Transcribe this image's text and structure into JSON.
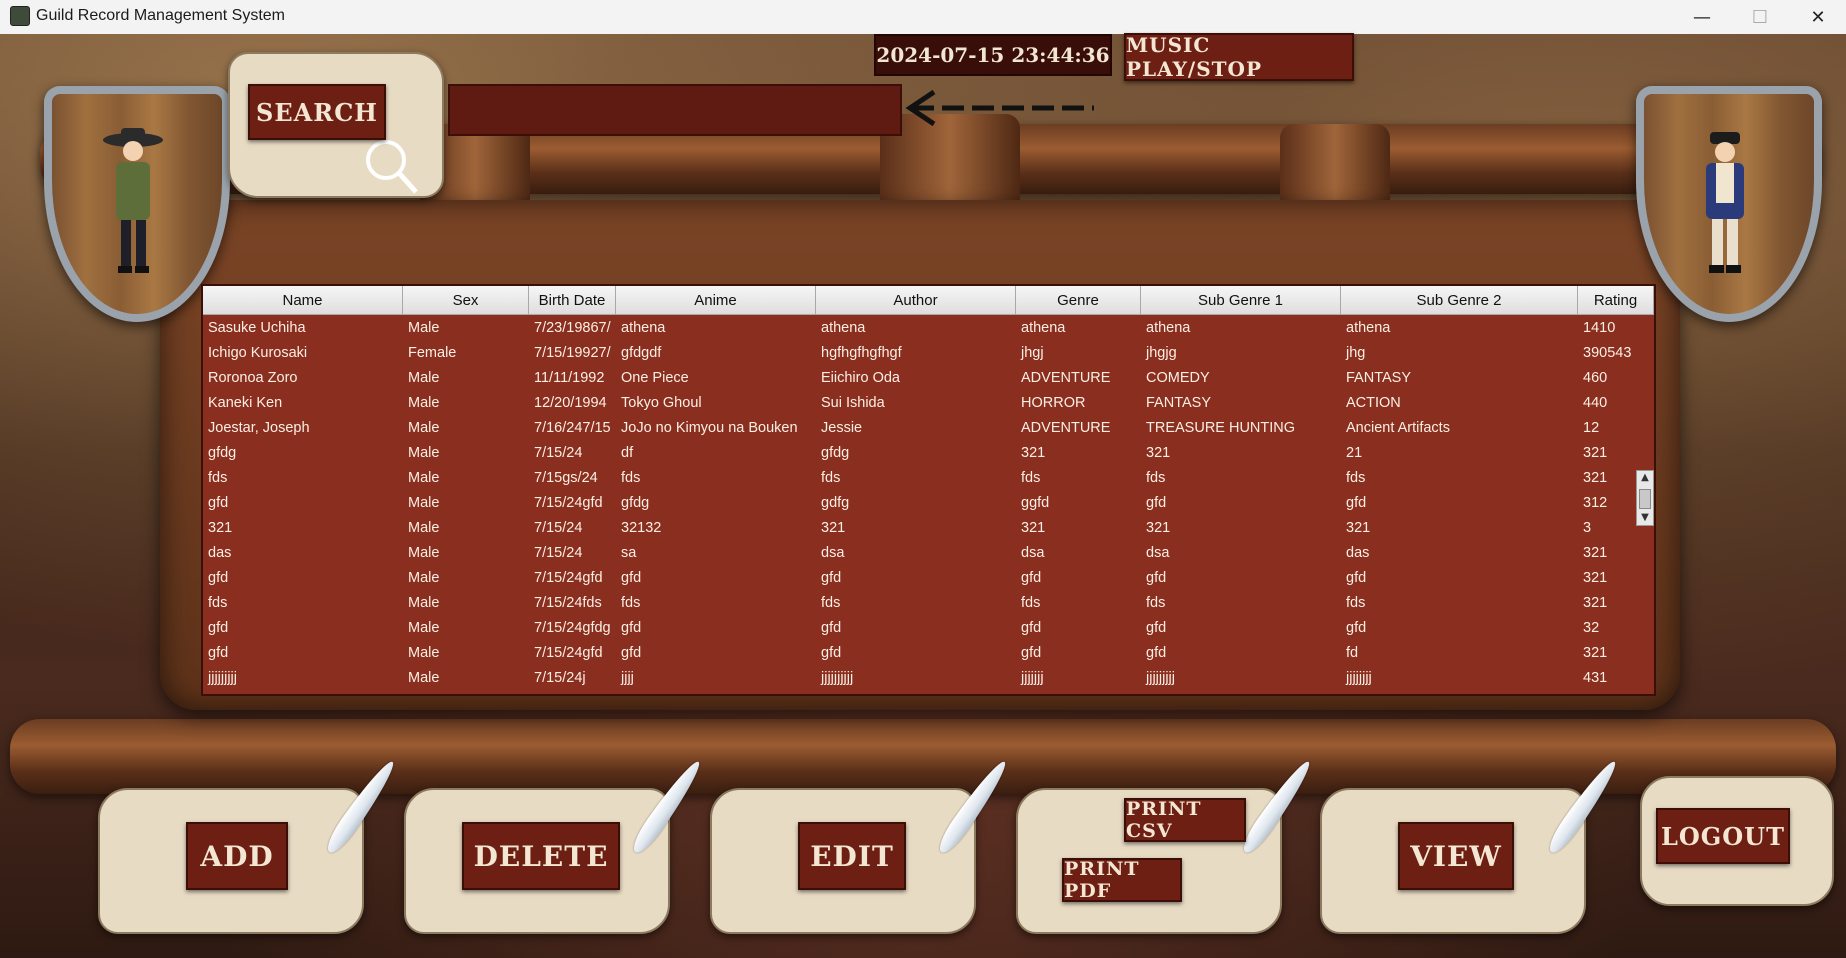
{
  "window": {
    "title": "Guild Record Management System",
    "minimize": "—",
    "maximize": "☐",
    "close": "✕"
  },
  "header": {
    "clock": "2024-07-15 23:44:36",
    "music_label": "MUSIC PLAY/STOP",
    "search_label": "SEARCH",
    "search_value": ""
  },
  "table": {
    "columns": [
      "Name",
      "Sex",
      "Birth Date",
      "Anime",
      "Author",
      "Genre",
      "Sub Genre 1",
      "Sub Genre 2",
      "Rating"
    ],
    "rows": [
      [
        "Sasuke Uchiha",
        "Male",
        "7/23/19867/",
        "athena",
        "athena",
        "athena",
        "athena",
        "athena",
        "1410"
      ],
      [
        "Ichigo Kurosaki",
        "Female",
        "7/15/19927/",
        "gfdgdf",
        "hgfhgfhgfhgf",
        "jhgj",
        "jhgjg",
        "jhg",
        "390543"
      ],
      [
        "Roronoa Zoro",
        "Male",
        "11/11/1992",
        "One Piece",
        "Eiichiro Oda",
        "ADVENTURE",
        "COMEDY",
        "FANTASY",
        "460"
      ],
      [
        "Kaneki Ken",
        "Male",
        "12/20/1994",
        "Tokyo Ghoul",
        "Sui Ishida",
        "HORROR",
        "FANTASY",
        "ACTION",
        "440"
      ],
      [
        "Joestar, Joseph",
        "Male",
        "7/16/247/15",
        "JoJo no Kimyou na Bouken",
        "Jessie",
        "ADVENTURE",
        "TREASURE HUNTING",
        "Ancient Artifacts",
        "12"
      ],
      [
        "gfdg",
        "Male",
        "7/15/24",
        "df",
        "gfdg",
        "321",
        "321",
        "21",
        "321"
      ],
      [
        "fds",
        "Male",
        "7/15gs/24",
        "fds",
        "fds",
        "fds",
        "fds",
        "fds",
        "321"
      ],
      [
        "gfd",
        "Male",
        "7/15/24gfd",
        "gfdg",
        "gdfg",
        "ggfd",
        "gfd",
        "gfd",
        "312"
      ],
      [
        "321",
        "Male",
        "7/15/24",
        "32132",
        "321",
        "321",
        "321",
        "321",
        "3"
      ],
      [
        "das",
        "Male",
        "7/15/24",
        "sa",
        "dsa",
        "dsa",
        "dsa",
        "das",
        "321"
      ],
      [
        "gfd",
        "Male",
        "7/15/24gfd",
        "gfd",
        "gfd",
        "gfd",
        "gfd",
        "gfd",
        "321"
      ],
      [
        "fds",
        "Male",
        "7/15/24fds",
        "fds",
        "fds",
        "fds",
        "fds",
        "fds",
        "321"
      ],
      [
        "gfd",
        "Male",
        "7/15/24gfdg",
        "gfd",
        "gfd",
        "gfd",
        "gfd",
        "gfd",
        "32"
      ],
      [
        "gfd",
        "Male",
        "7/15/24gfd",
        "gfd",
        "gfd",
        "gfd",
        "gfd",
        "fd",
        "321"
      ],
      [
        "jjjjjjjjj",
        "Male",
        "7/15/24j",
        "jjjj",
        "jjjjjjjjjj",
        "jjjjjjj",
        "jjjjjjjjj",
        "jjjjjjjj",
        "431"
      ]
    ]
  },
  "actions": {
    "add": "ADD",
    "delete": "DELETE",
    "edit": "EDIT",
    "print_csv": "PRINT CSV",
    "print_pdf": "PRINT PDF",
    "view": "VIEW",
    "logout": "LOGOUT"
  },
  "colors": {
    "button_bg": "#6e1f14",
    "table_bg": "#8a2e1f",
    "scroll_paper": "#e8dbc4"
  }
}
